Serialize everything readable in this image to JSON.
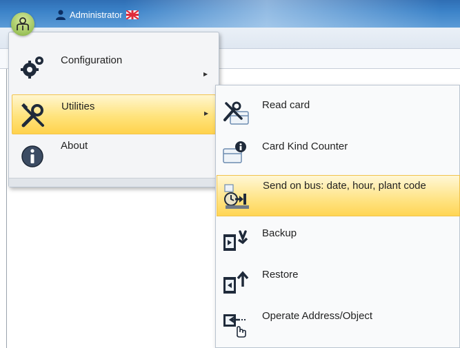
{
  "header": {
    "user_name": "Administrator"
  },
  "menu": {
    "items": [
      {
        "label": "Configuration",
        "icon": "gears-icon",
        "has_submenu": true
      },
      {
        "label": "Utilities",
        "icon": "tools-icon",
        "has_submenu": true,
        "selected": true
      },
      {
        "label": "About",
        "icon": "info-icon",
        "has_submenu": false
      }
    ]
  },
  "submenu": {
    "items": [
      {
        "label": "Read card",
        "icon": "read-card-icon"
      },
      {
        "label": "Card Kind Counter",
        "icon": "card-info-icon"
      },
      {
        "label": "Send on bus: date, hour, plant code",
        "icon": "send-bus-icon",
        "highlighted": true
      },
      {
        "label": "Backup",
        "icon": "backup-icon"
      },
      {
        "label": "Restore",
        "icon": "restore-icon"
      },
      {
        "label": "Operate Address/Object",
        "icon": "operate-address-icon"
      }
    ]
  },
  "colors": {
    "highlight": "#ffd95e",
    "titlebar": "#3b82c8",
    "app_button": "#9cc25a"
  }
}
